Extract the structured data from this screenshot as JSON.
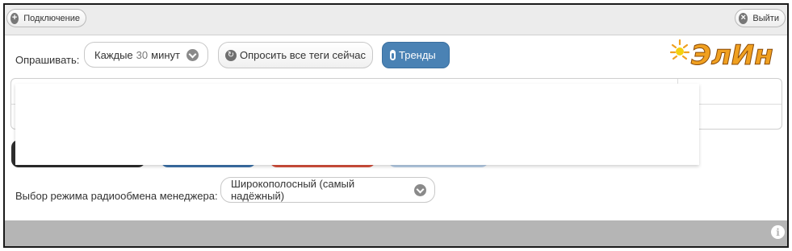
{
  "topbar": {
    "connect_label": "Подключение",
    "logout_label": "Выйти"
  },
  "logo": {
    "text": "ЭлИн",
    "color": "#f0a020"
  },
  "polling": {
    "label": "Опрашивать:",
    "interval_prefix": "Каждые",
    "interval_minutes": "30",
    "interval_suffix": "минут",
    "poll_now_label": "Опросить все теги сейчас",
    "trends_label": "Тренды"
  },
  "radio_mode": {
    "label": "Выбор режима радиообмена менеджера:",
    "selected": "Широкополосный (самый надёжный)"
  },
  "colors": {
    "trends_button": "#4a82b4",
    "footer": "#b5b5b5"
  }
}
